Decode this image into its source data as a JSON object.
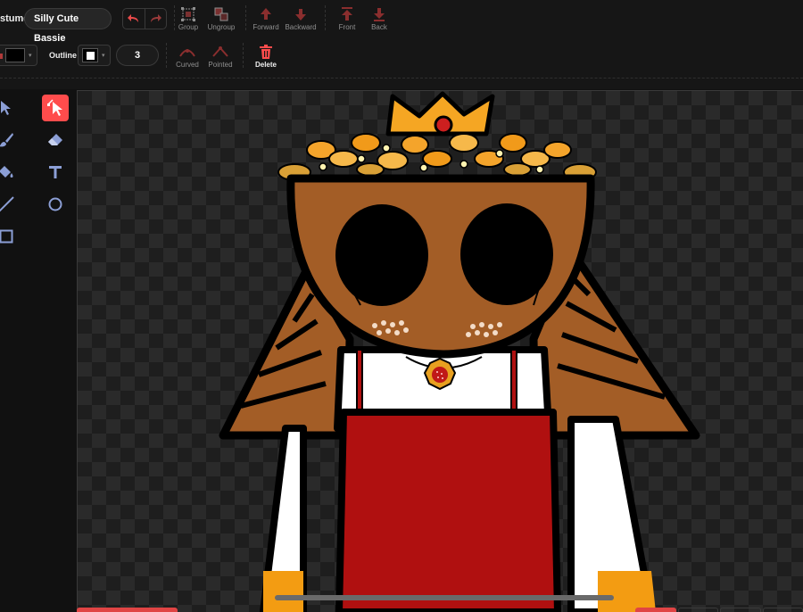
{
  "costume": {
    "label": "stume",
    "name": "Silly Cute Bassie"
  },
  "toolbar": {
    "group_label": "Group",
    "ungroup_label": "Ungroup",
    "forward_label": "Forward",
    "backward_label": "Backward",
    "front_label": "Front",
    "back_label": "Back",
    "curved_label": "Curved",
    "pointed_label": "Pointed",
    "delete_label": "Delete",
    "outline_label": "Outline",
    "outline_width": "3",
    "fill_color": "#000000",
    "outline_color": "#ffffff"
  },
  "tools": [
    "select",
    "reshape",
    "brush",
    "eraser",
    "fill",
    "text",
    "line",
    "circle",
    "rectangle"
  ],
  "active_tool": "reshape",
  "colors": {
    "accent": "#ff4c4c",
    "icon": "#8c9fd6",
    "disabled": "#8f8f8f"
  }
}
